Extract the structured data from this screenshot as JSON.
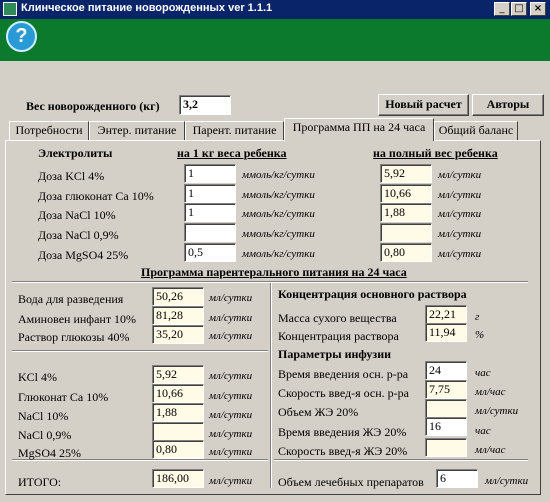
{
  "window": {
    "title": "Клинческое питание новорожденных ver 1.1.1",
    "min": "_",
    "max": "□",
    "close": "×"
  },
  "help_label": "?",
  "weight": {
    "label": "Вес новорожденного (кг)",
    "value": "3,2"
  },
  "buttons": {
    "new_calc": "Новый расчет",
    "authors": "Авторы"
  },
  "tabs": [
    "Потребности",
    "Энтер. питание",
    "Парент. питание",
    "Программа ПП на 24 часа",
    "Общий баланс"
  ],
  "electrolytes": {
    "title": "Электролиты",
    "per_kg_header": "на 1 кг веса ребенка",
    "total_header": "на полный вес ребенка",
    "rows": [
      {
        "label": "Доза KCl 4%",
        "per_kg": "1",
        "unit_kg": "ммоль/кг/сутки",
        "total": "5,92",
        "unit_total": "мл/сутки"
      },
      {
        "label": "Доза глюконат Ca 10%",
        "per_kg": "1",
        "unit_kg": "ммоль/кг/сутки",
        "total": "10,66",
        "unit_total": "мл/сутки"
      },
      {
        "label": "Доза NaCl 10%",
        "per_kg": "1",
        "unit_kg": "ммоль/кг/сутки",
        "total": "1,88",
        "unit_total": "мл/сутки"
      },
      {
        "label": "Доза NaCl 0,9%",
        "per_kg": "",
        "unit_kg": "ммоль/кг/сутки",
        "total": "",
        "unit_total": "мл/сутки"
      },
      {
        "label": "Доза MgSO4 25%",
        "per_kg": "0,5",
        "unit_kg": "ммоль/кг/сутки",
        "total": "0,80",
        "unit_total": "мл/сутки"
      }
    ]
  },
  "program": {
    "title": "Программа парентерального питания на 24 часа",
    "solutions": [
      {
        "label": "Вода для разведения",
        "value": "50,26",
        "unit": "мл/сутки"
      },
      {
        "label": "Аминовен инфант 10%",
        "value": "81,28",
        "unit": "мл/сутки"
      },
      {
        "label": "Раствор глюкозы 40%",
        "value": "35,20",
        "unit": "мл/сутки"
      }
    ],
    "electrolytes": [
      {
        "label": "KCl 4%",
        "value": "5,92",
        "unit": "мл/сутки"
      },
      {
        "label": "Глюконат Ca 10%",
        "value": "10,66",
        "unit": "мл/сутки"
      },
      {
        "label": "NaCl 10%",
        "value": "1,88",
        "unit": "мл/сутки"
      },
      {
        "label": "NaCl 0,9%",
        "value": "",
        "unit": "мл/сутки"
      },
      {
        "label": "MgSO4 25%",
        "value": "0,80",
        "unit": "мл/сутки"
      }
    ],
    "total": {
      "label": "ИТОГО:",
      "value": "186,00",
      "unit": "мл/сутки"
    }
  },
  "concentration": {
    "title": "Концентрация основного раствора",
    "rows": [
      {
        "label": "Масса сухого вещества",
        "value": "22,21",
        "unit": "г"
      },
      {
        "label": "Концентрация раствора",
        "value": "11,94",
        "unit": "%"
      }
    ]
  },
  "infusion": {
    "title": "Параметры инфузии",
    "rows": [
      {
        "label": "Время введения осн. р-ра",
        "value": "24",
        "unit": "час"
      },
      {
        "label": "Скорость введ-я осн. р-ра",
        "value": "7,75",
        "unit": "мл/час"
      },
      {
        "label": "Объем ЖЭ 20%",
        "value": "",
        "unit": "мл/сутки"
      },
      {
        "label": "Время введения ЖЭ 20%",
        "value": "16",
        "unit": "час"
      },
      {
        "label": "Скорость введ-я ЖЭ 20%",
        "value": "",
        "unit": "мл/час"
      }
    ],
    "drugs": {
      "label": "Объем лечебных препаратов",
      "value": "6",
      "unit": "мл/сутки"
    }
  }
}
